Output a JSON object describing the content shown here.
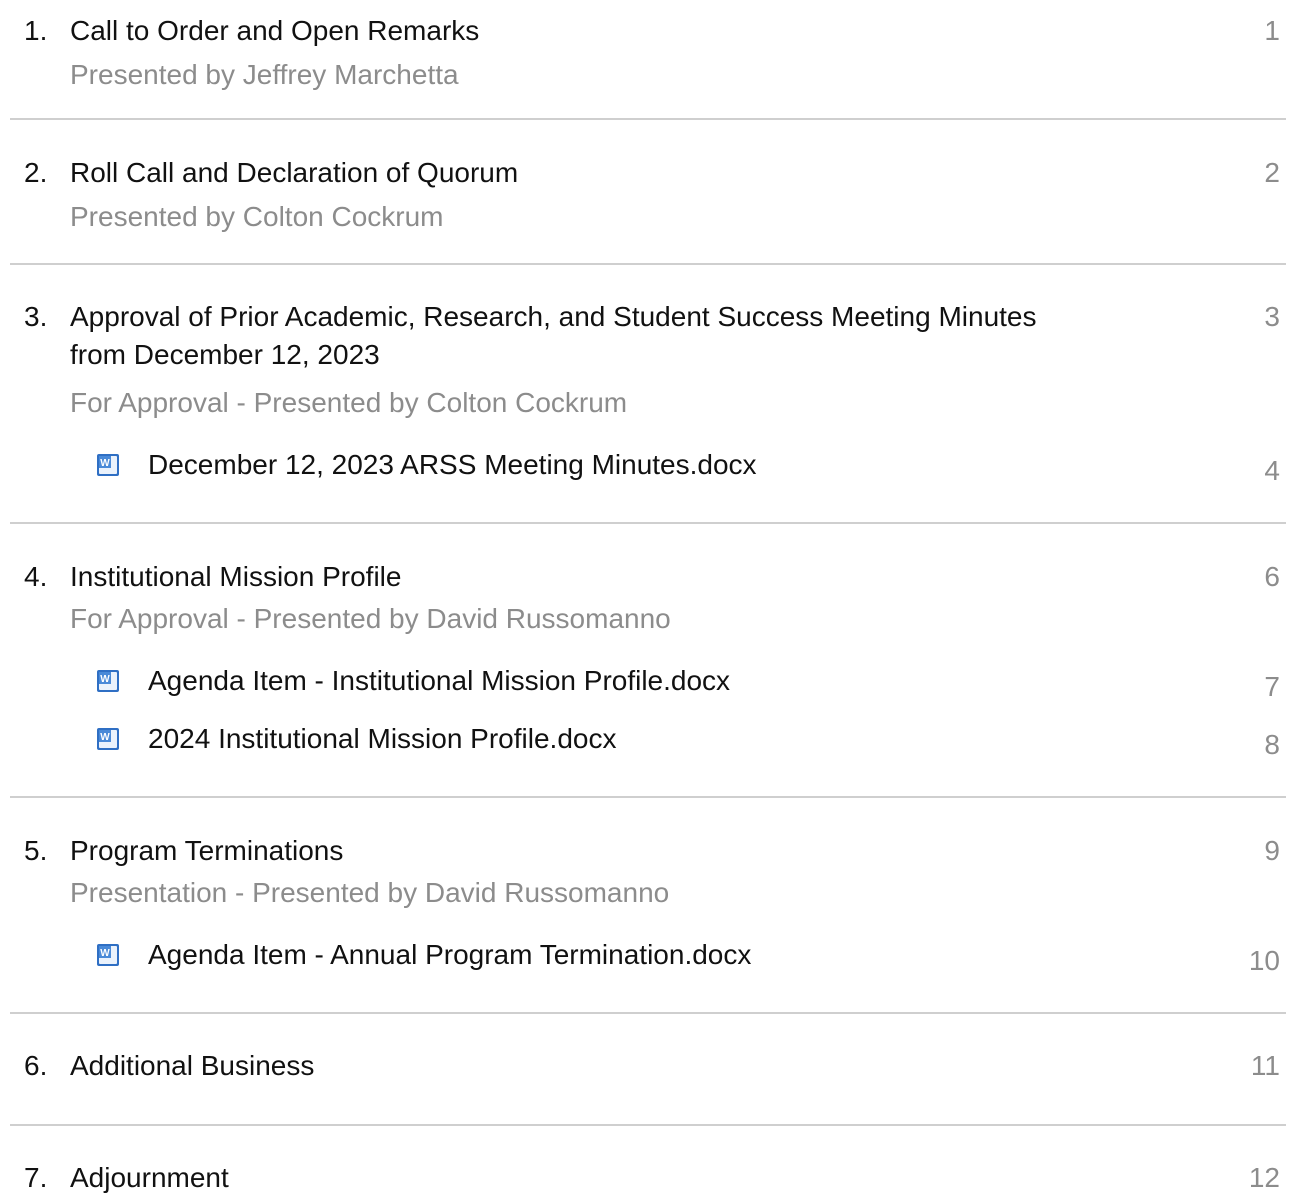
{
  "agenda": [
    {
      "number": "1.",
      "title": "Call to Order and Open Remarks",
      "subtitle": "Presented by Jeffrey Marchetta",
      "page": "1",
      "attachments": []
    },
    {
      "number": "2.",
      "title": "Roll Call and Declaration of Quorum",
      "subtitle": "Presented by Colton Cockrum",
      "page": "2",
      "attachments": []
    },
    {
      "number": "3.",
      "title": "Approval of Prior Academic, Research, and Student Success Meeting Minutes from December 12, 2023",
      "subtitle": "For Approval - Presented by Colton Cockrum",
      "page": "3",
      "attachments": [
        {
          "label": "December 12, 2023 ARSS Meeting Minutes.docx",
          "page": "4",
          "icon": "word-document-icon"
        }
      ]
    },
    {
      "number": "4.",
      "title": "Institutional Mission Profile",
      "subtitle": "For Approval - Presented by David Russomanno",
      "page": "6",
      "attachments": [
        {
          "label": "Agenda Item - Institutional Mission Profile.docx",
          "page": "7",
          "icon": "word-document-icon"
        },
        {
          "label": "2024 Institutional Mission Profile.docx",
          "page": "8",
          "icon": "word-document-icon"
        }
      ]
    },
    {
      "number": "5.",
      "title": "Program Terminations",
      "subtitle": "Presentation - Presented by David Russomanno",
      "page": "9",
      "attachments": [
        {
          "label": "Agenda Item - Annual Program Termination.docx",
          "page": "10",
          "icon": "word-document-icon"
        }
      ]
    },
    {
      "number": "6.",
      "title": "Additional Business",
      "subtitle": "",
      "page": "11",
      "attachments": []
    },
    {
      "number": "7.",
      "title": "Adjournment",
      "subtitle": "",
      "page": "12",
      "attachments": []
    }
  ],
  "colors": {
    "text": "#111111",
    "muted": "#8c8c8c",
    "divider": "#cfcfcf",
    "icon_blue": "#2f6fc4"
  }
}
